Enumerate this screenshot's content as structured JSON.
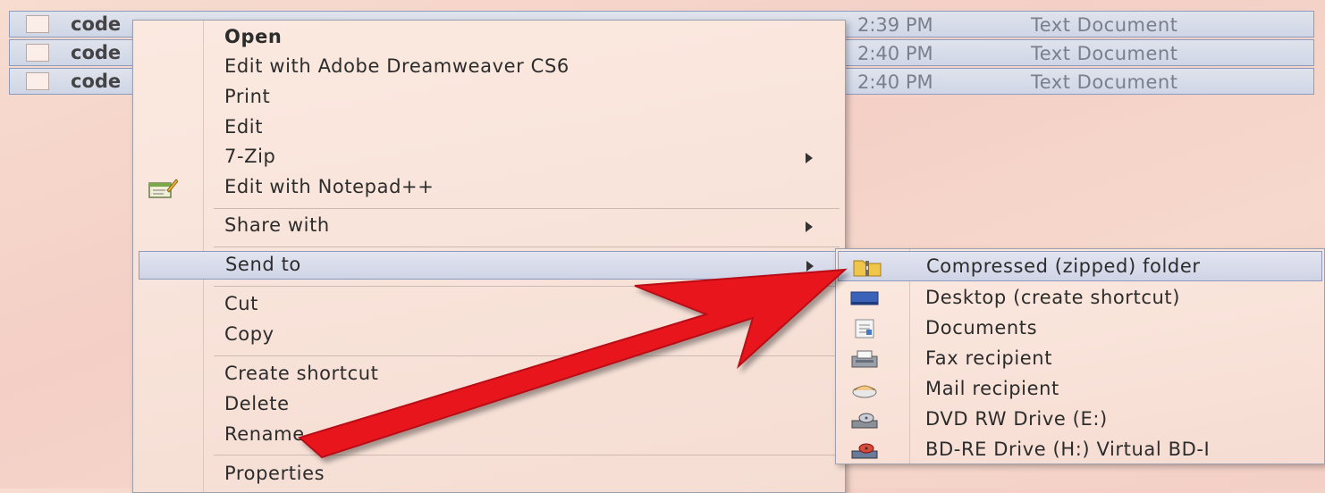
{
  "files": [
    {
      "name": "code",
      "time": "2:39 PM",
      "type": "Text Document"
    },
    {
      "name": "code",
      "time": "2:40 PM",
      "type": "Text Document"
    },
    {
      "name": "code",
      "time": "2:40 PM",
      "type": "Text Document"
    }
  ],
  "context_menu": {
    "items": [
      {
        "label": "Open",
        "bold": true
      },
      {
        "label": "Edit with Adobe Dreamweaver CS6"
      },
      {
        "label": "Print"
      },
      {
        "label": "Edit"
      },
      {
        "label": "7-Zip",
        "submenu": true
      },
      {
        "label": "Edit with Notepad++",
        "icon": "notepad-plus-plus-icon"
      },
      {
        "label": "Share with",
        "submenu": true
      },
      {
        "label": "Send to",
        "submenu": true,
        "highlighted": true
      },
      {
        "label": "Cut"
      },
      {
        "label": "Copy"
      },
      {
        "label": "Create shortcut"
      },
      {
        "label": "Delete"
      },
      {
        "label": "Rename"
      },
      {
        "label": "Properties"
      }
    ]
  },
  "send_to_menu": {
    "items": [
      {
        "label": "Compressed (zipped) folder",
        "icon": "zip-folder-icon",
        "highlighted": true
      },
      {
        "label": "Desktop (create shortcut)",
        "icon": "desktop-icon"
      },
      {
        "label": "Documents",
        "icon": "documents-icon"
      },
      {
        "label": "Fax recipient",
        "icon": "fax-icon"
      },
      {
        "label": "Mail recipient",
        "icon": "mail-icon"
      },
      {
        "label": "DVD RW Drive (E:)",
        "icon": "dvd-drive-icon"
      },
      {
        "label": "BD-RE Drive (H:) Virtual BD-I",
        "icon": "bd-drive-icon"
      }
    ]
  },
  "colors": {
    "highlight": "#cfd4e6",
    "annotation_arrow": "#e8141c"
  }
}
